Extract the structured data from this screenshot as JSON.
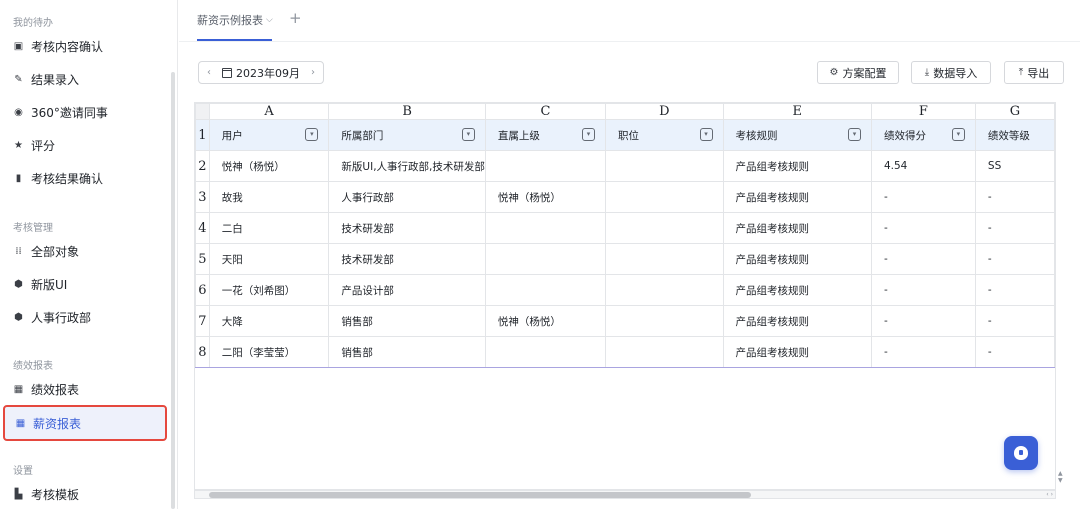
{
  "sidebar": {
    "sections": [
      {
        "title": "我的待办",
        "items": [
          {
            "label": "考核内容确认",
            "icon": "clipboard-icon"
          },
          {
            "label": "结果录入",
            "icon": "pen-icon"
          },
          {
            "label": "360°邀请同事",
            "icon": "target-icon"
          },
          {
            "label": "评分",
            "icon": "star-icon"
          },
          {
            "label": "考核结果确认",
            "icon": "bookmark-icon"
          }
        ]
      },
      {
        "title": "考核管理",
        "items": [
          {
            "label": "全部对象",
            "icon": "dots-grid-icon"
          },
          {
            "label": "新版UI",
            "icon": "shield-icon"
          },
          {
            "label": "人事行政部",
            "icon": "shield-icon"
          }
        ]
      },
      {
        "title": "绩效报表",
        "items": [
          {
            "label": "绩效报表",
            "icon": "report-icon"
          },
          {
            "label": "薪资报表",
            "icon": "report-icon",
            "active": true
          }
        ]
      },
      {
        "title": "设置",
        "items": [
          {
            "label": "考核模板",
            "icon": "template-icon"
          }
        ]
      }
    ]
  },
  "tabs": {
    "active_label": "薪资示例报表",
    "add_symbol": "+"
  },
  "month_nav": {
    "label": "2023年09月",
    "prev": "‹",
    "next": "›"
  },
  "actions": {
    "config": "方案配置",
    "import": "数据导入",
    "export": "导出"
  },
  "grid": {
    "columns": [
      "A",
      "B",
      "C",
      "D",
      "E",
      "F",
      "G"
    ],
    "header": [
      "用户",
      "所属部门",
      "直属上级",
      "职位",
      "考核规则",
      "绩效得分",
      "绩效等级"
    ],
    "rows": [
      [
        "悦神（杨悦）",
        "新版UI,人事行政部,技术研发部",
        "",
        "",
        "产品组考核规则",
        "4.54",
        "SS"
      ],
      [
        "故我",
        "人事行政部",
        "悦神（杨悦）",
        "",
        "产品组考核规则",
        "-",
        "-"
      ],
      [
        "二白",
        "技术研发部",
        "",
        "",
        "产品组考核规则",
        "-",
        "-"
      ],
      [
        "天阳",
        "技术研发部",
        "",
        "",
        "产品组考核规则",
        "-",
        "-"
      ],
      [
        "一花（刘希图）",
        "产品设计部",
        "",
        "",
        "产品组考核规则",
        "-",
        "-"
      ],
      [
        "大降",
        "销售部",
        "悦神（杨悦）",
        "",
        "产品组考核规则",
        "-",
        "-"
      ],
      [
        "二阳（李莹莹）",
        "销售部",
        "",
        "",
        "产品组考核规则",
        "-",
        "-"
      ]
    ]
  },
  "colors": {
    "accent": "#3a5fd6",
    "active_border": "#e5483e",
    "header_bg": "#eaf2fc"
  }
}
